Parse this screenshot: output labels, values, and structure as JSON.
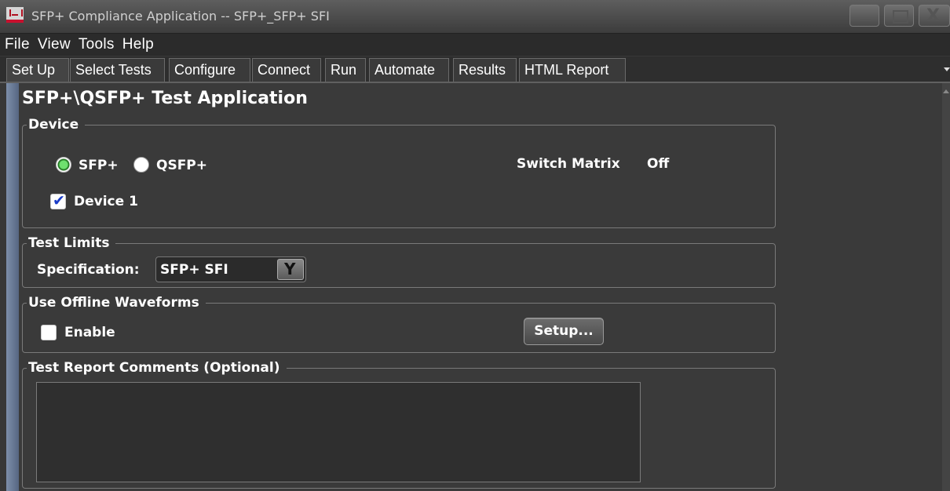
{
  "window": {
    "title": "SFP+ Compliance Application -- SFP+_SFP+ SFI"
  },
  "menu": [
    "File",
    "View",
    "Tools",
    "Help"
  ],
  "tabs": [
    "Set Up",
    "Select Tests",
    "Configure",
    "Connect",
    "Run",
    "Automate",
    "Results",
    "HTML Report"
  ],
  "active_tab": "Set Up",
  "page": {
    "title": "SFP+\\QSFP+ Test Application"
  },
  "device": {
    "legend": "Device",
    "radio_sfp": "SFP+",
    "radio_qsfp": "QSFP+",
    "selected": "SFP+",
    "switch_matrix_label": "Switch Matrix",
    "switch_matrix_value": "Off",
    "device1_label": "Device 1",
    "device1_checked": true
  },
  "test_limits": {
    "legend": "Test Limits",
    "spec_label": "Specification:",
    "spec_value": "SFP+ SFI"
  },
  "offline": {
    "legend": "Use Offline Waveforms",
    "enable_label": "Enable",
    "enable_checked": false,
    "setup_label": "Setup..."
  },
  "comments": {
    "legend": "Test Report Comments (Optional)",
    "value": ""
  },
  "icons": {
    "app": "app-icon",
    "minimize": "minimize-icon",
    "maximize": "maximize-icon",
    "close": "close-icon",
    "dropdown": "chevron-down-icon"
  }
}
